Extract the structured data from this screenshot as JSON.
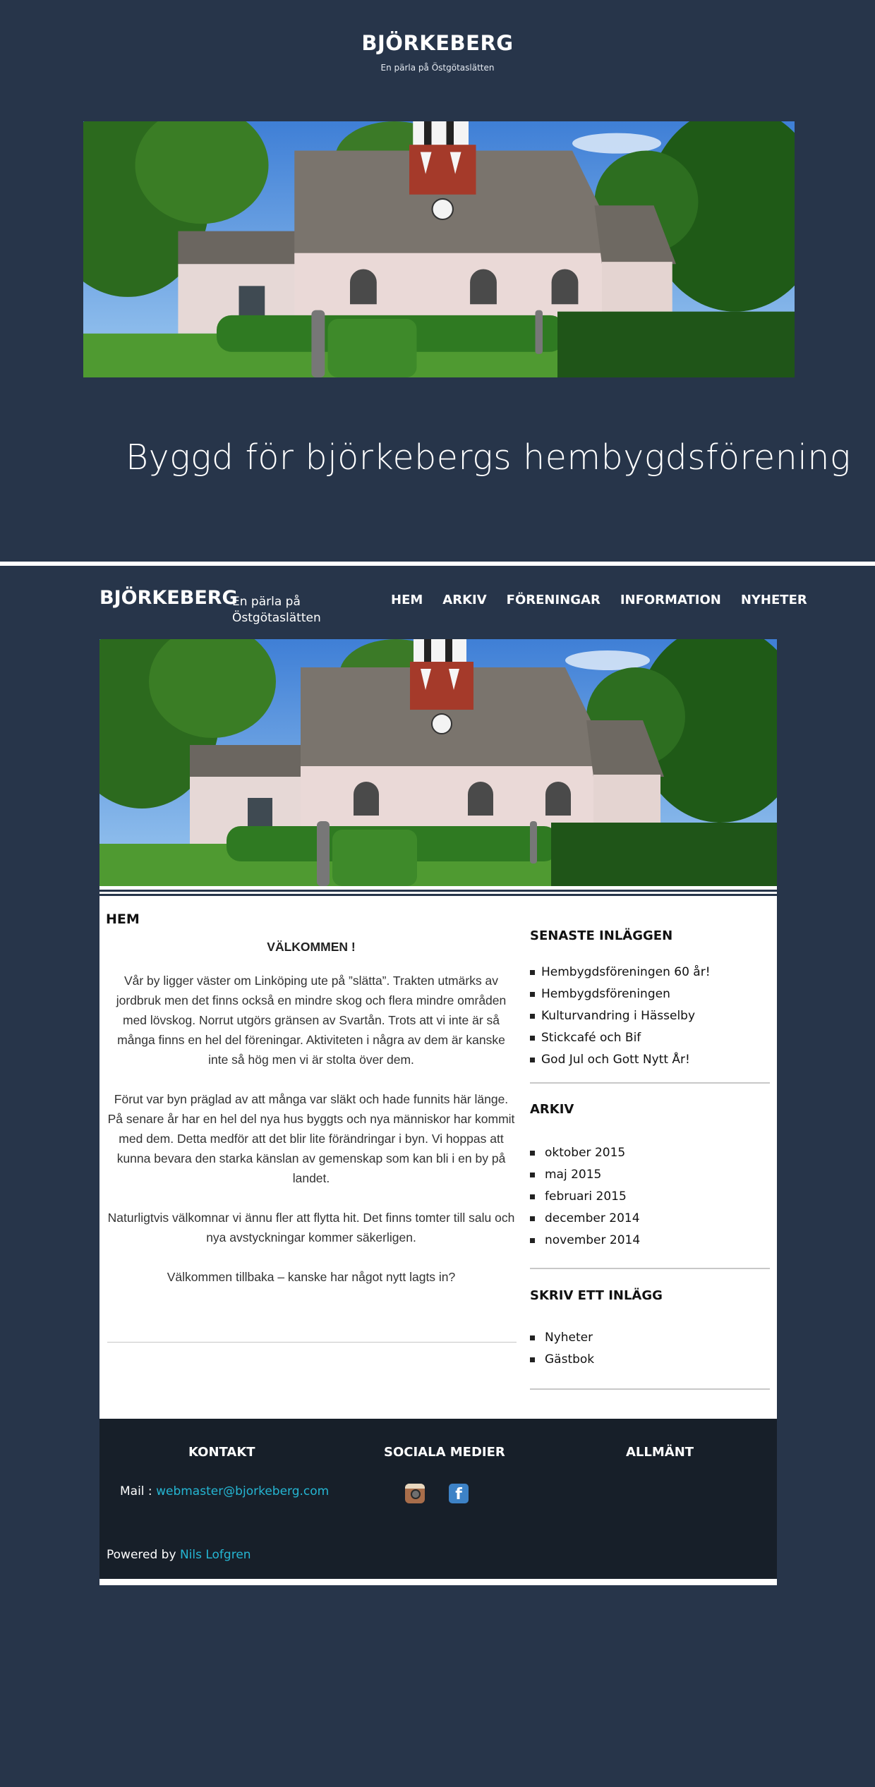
{
  "site": {
    "title": "BJÖRKEBERG",
    "tagline": "En pärla på Östgötaslätten",
    "hero_heading": "Byggd för björkebergs hembygdsförening"
  },
  "nav": {
    "items": [
      "HEM",
      "ARKIV",
      "FÖRENINGAR",
      "INFORMATION",
      "NYHETER"
    ]
  },
  "page": {
    "breadcrumb": "HEM",
    "heading": "VÄLKOMMEN !",
    "paragraphs": [
      "Vår by ligger väster om Linköping ute på ”slätta”. Trakten utmärks av jordbruk men det finns också en mindre skog och flera mindre områden med lövskog. Norrut utgörs gränsen av Svartån. Trots att vi inte är så många finns en hel del föreningar. Aktiviteten i några av dem är kanske inte så hög men vi är stolta över dem.",
      "Förut var byn präglad av att många var släkt och hade funnits här länge. På senare år har en hel del nya hus byggts och nya människor har kommit med dem. Detta medför att det blir lite förändringar i byn. Vi hoppas att kunna bevara den starka känslan av gemenskap som kan bli i en by på landet.",
      "Naturligtvis välkomnar vi ännu fler att flytta hit. Det finns tomter till salu och nya avstyckningar kommer säkerligen.",
      "Välkommen tillbaka – kanske har något nytt lagts in?"
    ]
  },
  "sidebar": {
    "recent": {
      "heading": "SENASTE INLÄGGEN",
      "items": [
        "Hembygdsföreningen 60 år!",
        "Hembygdsföreningen",
        "Kulturvandring i Hässelby",
        "Stickcafé och Bif",
        "God Jul och Gott Nytt År!"
      ]
    },
    "archive": {
      "heading": "ARKIV",
      "items": [
        "oktober 2015",
        "maj 2015",
        "februari 2015",
        "december 2014",
        "november 2014"
      ]
    },
    "write": {
      "heading": "SKRIV ETT INLÄGG",
      "items": [
        "Nyheter",
        "Gästbok"
      ]
    }
  },
  "footer": {
    "contact_heading": "KONTAKT",
    "social_heading": "SOCIALA MEDIER",
    "general_heading": "ALLMÄNT",
    "mail_label": "Mail :",
    "mail_value": "webmaster@bjorkeberg.com",
    "powered_label": "Powered by",
    "powered_author": "Nils Lofgren"
  },
  "icons": {
    "instagram": "instagram-icon",
    "facebook": "facebook-icon"
  },
  "colors": {
    "background": "#27354a",
    "footer": "#171f29",
    "link": "#25b6d3"
  }
}
